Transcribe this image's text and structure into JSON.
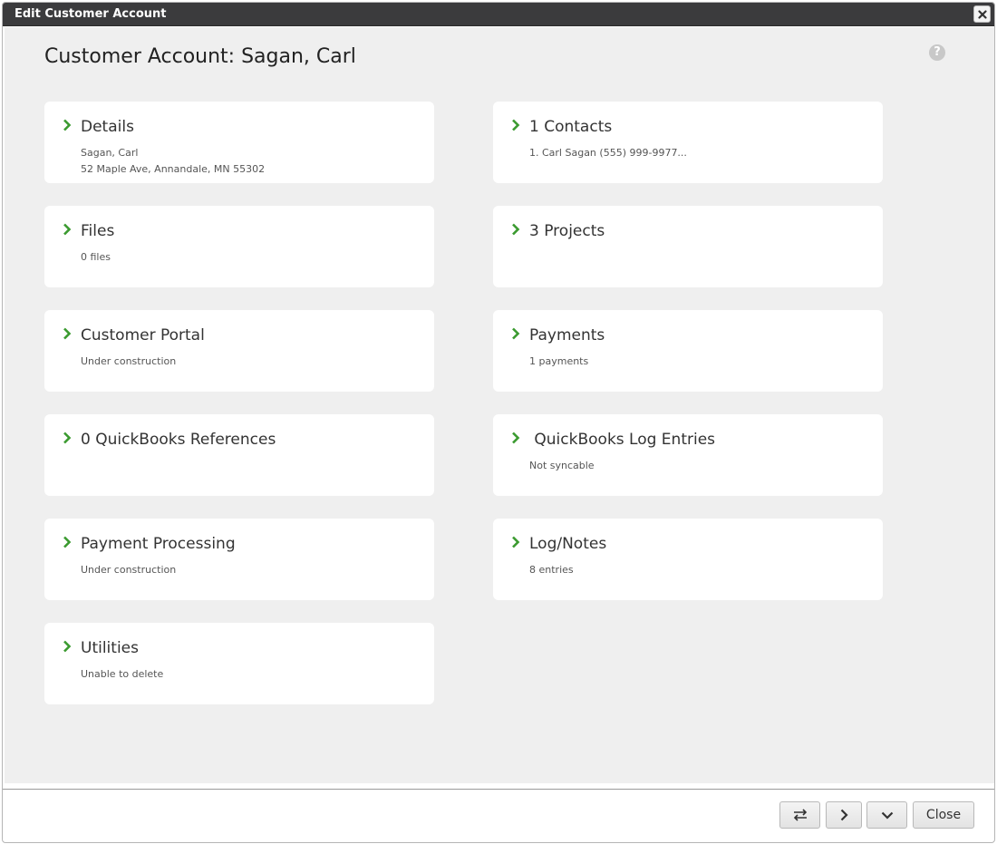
{
  "window": {
    "title": "Edit Customer Account",
    "close_icon": "close-icon"
  },
  "page": {
    "title": "Customer Account: Sagan, Carl",
    "help_glyph": "?"
  },
  "accent_color": "#3a9a2f",
  "cards": {
    "details": {
      "title": "Details",
      "line1": "Sagan, Carl",
      "line2": "52 Maple Ave, Annandale, MN 55302"
    },
    "contacts": {
      "title": "1 Contacts",
      "line1": "1. Carl Sagan (555) 999-9977..."
    },
    "files": {
      "title": "Files",
      "line1": "0 files"
    },
    "projects": {
      "title": "3 Projects",
      "line1": ""
    },
    "customer_portal": {
      "title": "Customer Portal",
      "line1": "Under construction"
    },
    "payments": {
      "title": "Payments",
      "line1": "1 payments"
    },
    "qb_references": {
      "title": "0 QuickBooks References",
      "line1": ""
    },
    "qb_log": {
      "title": " QuickBooks Log Entries",
      "line1": "Not syncable"
    },
    "payment_processing": {
      "title": "Payment Processing",
      "line1": "Under construction"
    },
    "log_notes": {
      "title": "Log/Notes",
      "line1": "8 entries"
    },
    "utilities": {
      "title": "Utilities",
      "line1": "Unable to delete"
    }
  },
  "footer": {
    "swap_icon": "swap-arrows-icon",
    "next_icon": "chevron-right-icon",
    "down_icon": "chevron-down-icon",
    "close_label": "Close"
  }
}
